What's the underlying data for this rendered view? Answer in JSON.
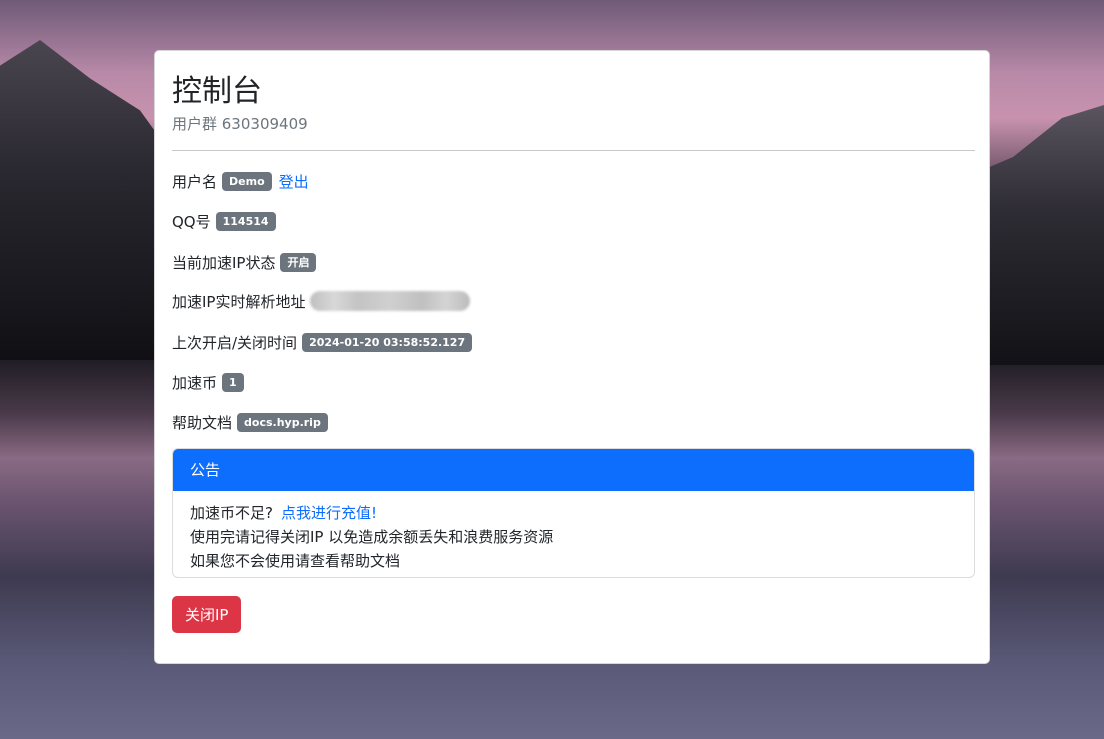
{
  "header": {
    "title": "控制台",
    "subtitle": "用户群 630309409"
  },
  "info": {
    "username_label": "用户名",
    "username_value": "Demo",
    "logout_link": "登出",
    "qq_label": "QQ号",
    "qq_value": "114514",
    "ip_status_label": "当前加速IP状态",
    "ip_status_value": "开启",
    "ip_address_label": "加速IP实时解析地址",
    "last_toggle_label": "上次开启/关闭时间",
    "last_toggle_value": "2024-01-20 03:58:52.127",
    "coins_label": "加速币",
    "coins_value": "1",
    "docs_label": "帮助文档",
    "docs_value": "docs.hyp.rip"
  },
  "notice": {
    "header": "公告",
    "line1_text": "加速币不足?",
    "line1_link": "点我进行充值!",
    "line2": "使用完请记得关闭IP 以免造成余额丢失和浪费服务资源",
    "line3": "如果您不会使用请查看帮助文档"
  },
  "actions": {
    "close_ip_button": "关闭IP"
  },
  "colors": {
    "primary": "#0d6efd",
    "danger": "#dc3545",
    "badge": "#6c757d"
  }
}
